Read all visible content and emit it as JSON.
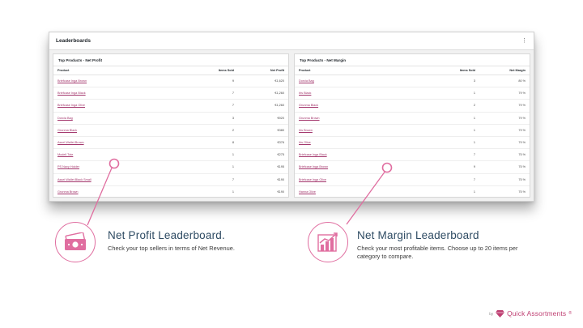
{
  "dashboard": {
    "title": "Leaderboards",
    "menu_glyph": "⋮",
    "profit": {
      "title": "Top Products - Net Profit",
      "columns": [
        "Product",
        "Items Sold",
        "Net Profit"
      ],
      "rows": [
        {
          "product": "Briefcase Inga Brown",
          "sold": "9",
          "value": "€1,620"
        },
        {
          "product": "Briefcase Inga Black",
          "sold": "7",
          "value": "€1,260"
        },
        {
          "product": "Briefcase Inga Olive",
          "sold": "7",
          "value": "€1,260"
        },
        {
          "product": "Dorcia Bag",
          "sold": "3",
          "value": "€920"
        },
        {
          "product": "Grunma Black",
          "sold": "2",
          "value": "€380"
        },
        {
          "product": "Assel Wallet Brown",
          "sold": "8",
          "value": "€376"
        },
        {
          "product": "Modell Tote",
          "sold": "1",
          "value": "€275"
        },
        {
          "product": "PS Navy Holder",
          "sold": "1",
          "value": "€195"
        },
        {
          "product": "Assel Wallet Black Small",
          "sold": "7",
          "value": "€190"
        },
        {
          "product": "Grunma Brown",
          "sold": "1",
          "value": "€190"
        }
      ]
    },
    "margin": {
      "title": "Top Products - Net Margin",
      "columns": [
        "Product",
        "Items Sold",
        "Net Margin"
      ],
      "rows": [
        {
          "product": "Dorcia Bag",
          "sold": "3",
          "value": "80 %"
        },
        {
          "product": "Iris Black",
          "sold": "1",
          "value": "79 %"
        },
        {
          "product": "Grunma Black",
          "sold": "2",
          "value": "79 %"
        },
        {
          "product": "Grunma Brown",
          "sold": "1",
          "value": "79 %"
        },
        {
          "product": "Iris Brown",
          "sold": "1",
          "value": "79 %"
        },
        {
          "product": "Iris Olive",
          "sold": "1",
          "value": "79 %"
        },
        {
          "product": "Briefcase Inga Black",
          "sold": "7",
          "value": "75 %"
        },
        {
          "product": "Briefcase Inga Brown",
          "sold": "9",
          "value": "75 %"
        },
        {
          "product": "Briefcase Inga Olive",
          "sold": "7",
          "value": "75 %"
        },
        {
          "product": "Hanna Olive",
          "sold": "1",
          "value": "75 %"
        }
      ]
    }
  },
  "features": [
    {
      "title": "Net Profit Leaderboard.",
      "description": "Check your top sellers in terms of Net Revenue.",
      "icon": "money-icon"
    },
    {
      "title": "Net Margin Leaderboard",
      "description": "Check your most profitable items. Choose up to 20 items per category to compare.",
      "icon": "bar-chart-growth-icon"
    }
  ],
  "brand": {
    "by": "by",
    "name": "Quick Assortments",
    "reg": "®"
  },
  "colors": {
    "accent": "#e06ea0",
    "title": "#2e4b63",
    "brand": "#bf3f72",
    "link": "#a3366c"
  }
}
